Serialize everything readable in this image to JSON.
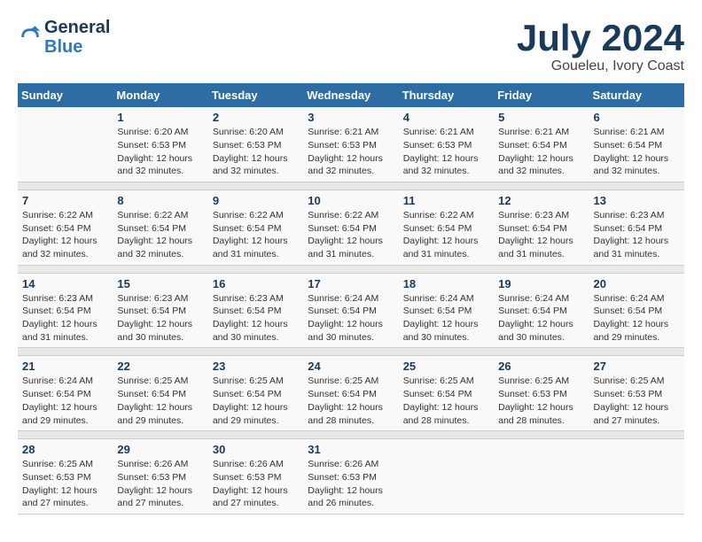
{
  "header": {
    "logo_line1": "General",
    "logo_line2": "Blue",
    "title": "July 2024",
    "location": "Goueleu, Ivory Coast"
  },
  "columns": [
    "Sunday",
    "Monday",
    "Tuesday",
    "Wednesday",
    "Thursday",
    "Friday",
    "Saturday"
  ],
  "weeks": [
    [
      {
        "day": "",
        "info": ""
      },
      {
        "day": "1",
        "info": "Sunrise: 6:20 AM\nSunset: 6:53 PM\nDaylight: 12 hours\nand 32 minutes."
      },
      {
        "day": "2",
        "info": "Sunrise: 6:20 AM\nSunset: 6:53 PM\nDaylight: 12 hours\nand 32 minutes."
      },
      {
        "day": "3",
        "info": "Sunrise: 6:21 AM\nSunset: 6:53 PM\nDaylight: 12 hours\nand 32 minutes."
      },
      {
        "day": "4",
        "info": "Sunrise: 6:21 AM\nSunset: 6:53 PM\nDaylight: 12 hours\nand 32 minutes."
      },
      {
        "day": "5",
        "info": "Sunrise: 6:21 AM\nSunset: 6:54 PM\nDaylight: 12 hours\nand 32 minutes."
      },
      {
        "day": "6",
        "info": "Sunrise: 6:21 AM\nSunset: 6:54 PM\nDaylight: 12 hours\nand 32 minutes."
      }
    ],
    [
      {
        "day": "7",
        "info": "Sunrise: 6:22 AM\nSunset: 6:54 PM\nDaylight: 12 hours\nand 32 minutes."
      },
      {
        "day": "8",
        "info": "Sunrise: 6:22 AM\nSunset: 6:54 PM\nDaylight: 12 hours\nand 32 minutes."
      },
      {
        "day": "9",
        "info": "Sunrise: 6:22 AM\nSunset: 6:54 PM\nDaylight: 12 hours\nand 31 minutes."
      },
      {
        "day": "10",
        "info": "Sunrise: 6:22 AM\nSunset: 6:54 PM\nDaylight: 12 hours\nand 31 minutes."
      },
      {
        "day": "11",
        "info": "Sunrise: 6:22 AM\nSunset: 6:54 PM\nDaylight: 12 hours\nand 31 minutes."
      },
      {
        "day": "12",
        "info": "Sunrise: 6:23 AM\nSunset: 6:54 PM\nDaylight: 12 hours\nand 31 minutes."
      },
      {
        "day": "13",
        "info": "Sunrise: 6:23 AM\nSunset: 6:54 PM\nDaylight: 12 hours\nand 31 minutes."
      }
    ],
    [
      {
        "day": "14",
        "info": "Sunrise: 6:23 AM\nSunset: 6:54 PM\nDaylight: 12 hours\nand 31 minutes."
      },
      {
        "day": "15",
        "info": "Sunrise: 6:23 AM\nSunset: 6:54 PM\nDaylight: 12 hours\nand 30 minutes."
      },
      {
        "day": "16",
        "info": "Sunrise: 6:23 AM\nSunset: 6:54 PM\nDaylight: 12 hours\nand 30 minutes."
      },
      {
        "day": "17",
        "info": "Sunrise: 6:24 AM\nSunset: 6:54 PM\nDaylight: 12 hours\nand 30 minutes."
      },
      {
        "day": "18",
        "info": "Sunrise: 6:24 AM\nSunset: 6:54 PM\nDaylight: 12 hours\nand 30 minutes."
      },
      {
        "day": "19",
        "info": "Sunrise: 6:24 AM\nSunset: 6:54 PM\nDaylight: 12 hours\nand 30 minutes."
      },
      {
        "day": "20",
        "info": "Sunrise: 6:24 AM\nSunset: 6:54 PM\nDaylight: 12 hours\nand 29 minutes."
      }
    ],
    [
      {
        "day": "21",
        "info": "Sunrise: 6:24 AM\nSunset: 6:54 PM\nDaylight: 12 hours\nand 29 minutes."
      },
      {
        "day": "22",
        "info": "Sunrise: 6:25 AM\nSunset: 6:54 PM\nDaylight: 12 hours\nand 29 minutes."
      },
      {
        "day": "23",
        "info": "Sunrise: 6:25 AM\nSunset: 6:54 PM\nDaylight: 12 hours\nand 29 minutes."
      },
      {
        "day": "24",
        "info": "Sunrise: 6:25 AM\nSunset: 6:54 PM\nDaylight: 12 hours\nand 28 minutes."
      },
      {
        "day": "25",
        "info": "Sunrise: 6:25 AM\nSunset: 6:54 PM\nDaylight: 12 hours\nand 28 minutes."
      },
      {
        "day": "26",
        "info": "Sunrise: 6:25 AM\nSunset: 6:53 PM\nDaylight: 12 hours\nand 28 minutes."
      },
      {
        "day": "27",
        "info": "Sunrise: 6:25 AM\nSunset: 6:53 PM\nDaylight: 12 hours\nand 27 minutes."
      }
    ],
    [
      {
        "day": "28",
        "info": "Sunrise: 6:25 AM\nSunset: 6:53 PM\nDaylight: 12 hours\nand 27 minutes."
      },
      {
        "day": "29",
        "info": "Sunrise: 6:26 AM\nSunset: 6:53 PM\nDaylight: 12 hours\nand 27 minutes."
      },
      {
        "day": "30",
        "info": "Sunrise: 6:26 AM\nSunset: 6:53 PM\nDaylight: 12 hours\nand 27 minutes."
      },
      {
        "day": "31",
        "info": "Sunrise: 6:26 AM\nSunset: 6:53 PM\nDaylight: 12 hours\nand 26 minutes."
      },
      {
        "day": "",
        "info": ""
      },
      {
        "day": "",
        "info": ""
      },
      {
        "day": "",
        "info": ""
      }
    ]
  ]
}
